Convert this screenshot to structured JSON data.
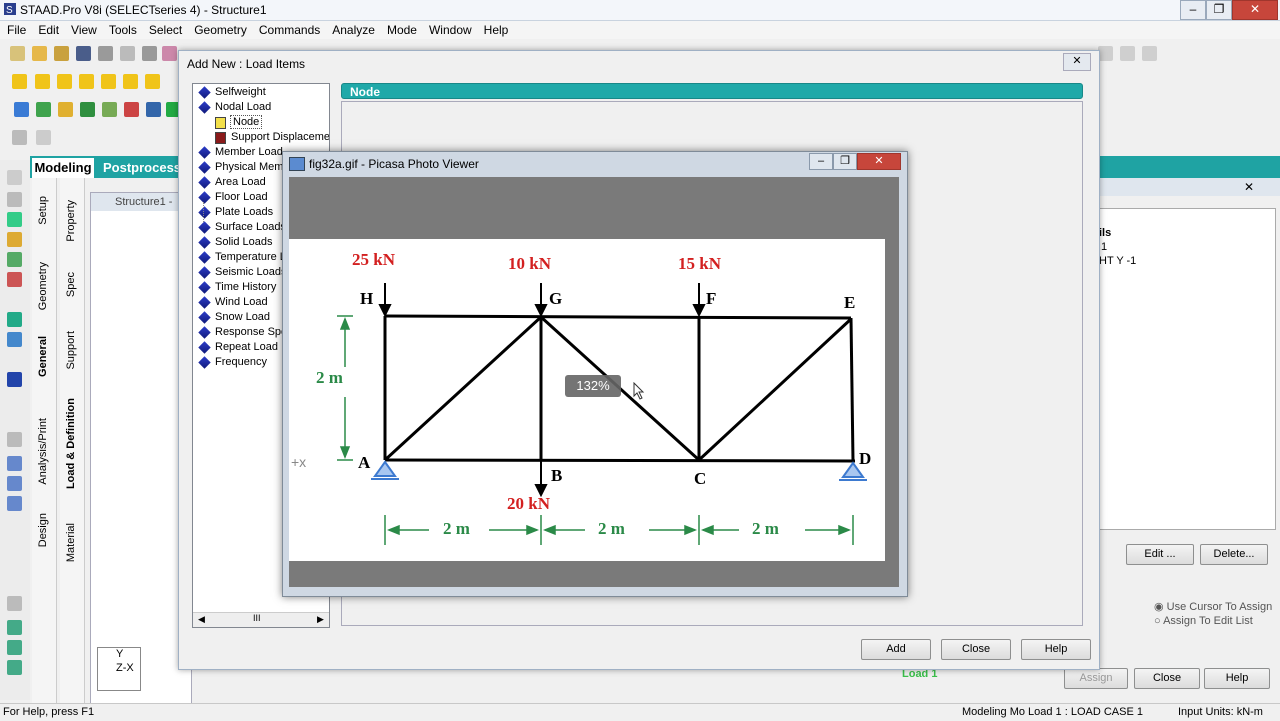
{
  "app": {
    "title": "STAAD.Pro V8i (SELECTseries 4) - Structure1"
  },
  "menu": [
    "File",
    "Edit",
    "View",
    "Tools",
    "Select",
    "Geometry",
    "Commands",
    "Analyze",
    "Mode",
    "Window",
    "Help"
  ],
  "main_tabs": {
    "modeling": "Modeling",
    "postprocess": "Postprocess"
  },
  "side_tabs_outer": [
    "Setup",
    "Geometry",
    "General",
    "Analysis/Print",
    "Design"
  ],
  "side_tabs_inner": [
    "Property",
    "Spec",
    "Support",
    "Load & Definition",
    "Material"
  ],
  "structure_window": {
    "title": "Structure1 - "
  },
  "dialog": {
    "title": "Add New : Load Items",
    "panel_header": "Node",
    "tree": [
      {
        "label": "Selfweight",
        "level": 0
      },
      {
        "label": "Nodal Load",
        "level": 0
      },
      {
        "label": "Node",
        "level": 1,
        "selected": true
      },
      {
        "label": "Support Displacemen",
        "level": 1
      },
      {
        "label": "Member Load",
        "level": 0
      },
      {
        "label": "Physical Memb",
        "level": 0
      },
      {
        "label": "Area Load",
        "level": 0
      },
      {
        "label": "Floor Load",
        "level": 0
      },
      {
        "label": "Plate Loads",
        "level": 0
      },
      {
        "label": "Surface Loads",
        "level": 0
      },
      {
        "label": "Solid Loads",
        "level": 0
      },
      {
        "label": "Temperature L",
        "level": 0
      },
      {
        "label": "Seismic Loads",
        "level": 0
      },
      {
        "label": "Time History",
        "level": 0
      },
      {
        "label": "Wind Load",
        "level": 0
      },
      {
        "label": "Snow Load",
        "level": 0
      },
      {
        "label": "Response Spe",
        "level": 0
      },
      {
        "label": "Repeat Load",
        "level": 0
      },
      {
        "label": "Frequency",
        "level": 0
      }
    ],
    "buttons": {
      "add": "Add",
      "close": "Close",
      "help": "Help"
    }
  },
  "right_panel": {
    "text1": "ils",
    "text2": "1",
    "text3": "HT Y -1",
    "edit": "Edit ...",
    "delete": "Delete...",
    "opt1": "Use Cursor To Assign",
    "opt2": "Assign To Edit List",
    "assign": "Assign",
    "close": "Close",
    "help": "Help",
    "load_label": "Load 1"
  },
  "picasa": {
    "title": "fig32a.gif - Picasa Photo Viewer",
    "zoom": "132%",
    "figure": {
      "loads": [
        "25 kN",
        "10 kN",
        "15 kN",
        "20 kN"
      ],
      "nodes": [
        "H",
        "G",
        "F",
        "E",
        "A",
        "B",
        "C",
        "D"
      ],
      "height": "2 m",
      "spans": [
        "2 m",
        "2 m",
        "2 m"
      ],
      "axis": "+x"
    }
  },
  "axis_widget": {
    "y": "Y",
    "zx": "Z-X"
  },
  "status": {
    "left": "For Help, press F1",
    "mid": "Modeling Mo  Load 1 : LOAD CASE 1",
    "right": "Input Units:  kN-m"
  }
}
